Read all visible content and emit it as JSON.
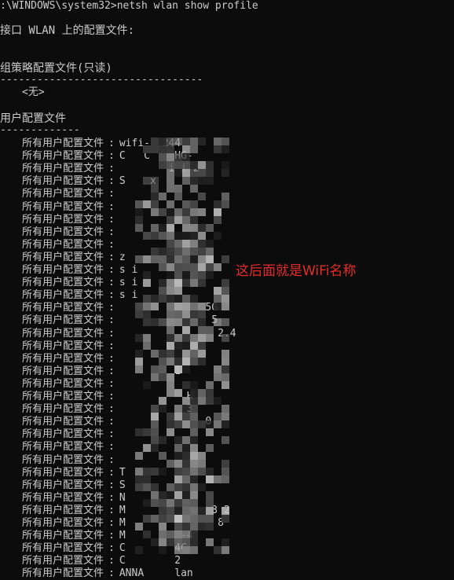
{
  "window": {
    "command_line": ":\\WINDOWS\\system32>netsh wlan show profile",
    "interface_line": "接口 WLAN 上的配置文件:",
    "group_policy": {
      "header": "组策略配置文件(只读)",
      "separator": "---------------------------------",
      "none_value": "<无>"
    },
    "user_profiles": {
      "header": "用户配置文件",
      "separator": "-------------",
      "label": "所有用户配置文件",
      "colon": ":",
      "items": [
        "wifi-  244",
        "C   C    HG-",
        "        i i 2",
        "S    x",
        "",
        "",
        "",
        "",
        "",
        "z",
        "s i",
        "s i",
        "s i",
        "              5G",
        "               5",
        "                2.4",
        "",
        "",
        "         1",
        "",
        "           H",
        "           3",
        "              0",
        "",
        "",
        "",
        "T",
        "S",
        "N",
        "M              3 2",
        "M               8",
        "M         -4",
        "C        4C",
        "C        2",
        "ANNA     lan"
      ]
    }
  },
  "annotation": {
    "text": "这后面就是WiFi名称",
    "color": "#e52b2b"
  },
  "colors": {
    "background": "#0c0c0c",
    "text": "#cccccc"
  }
}
